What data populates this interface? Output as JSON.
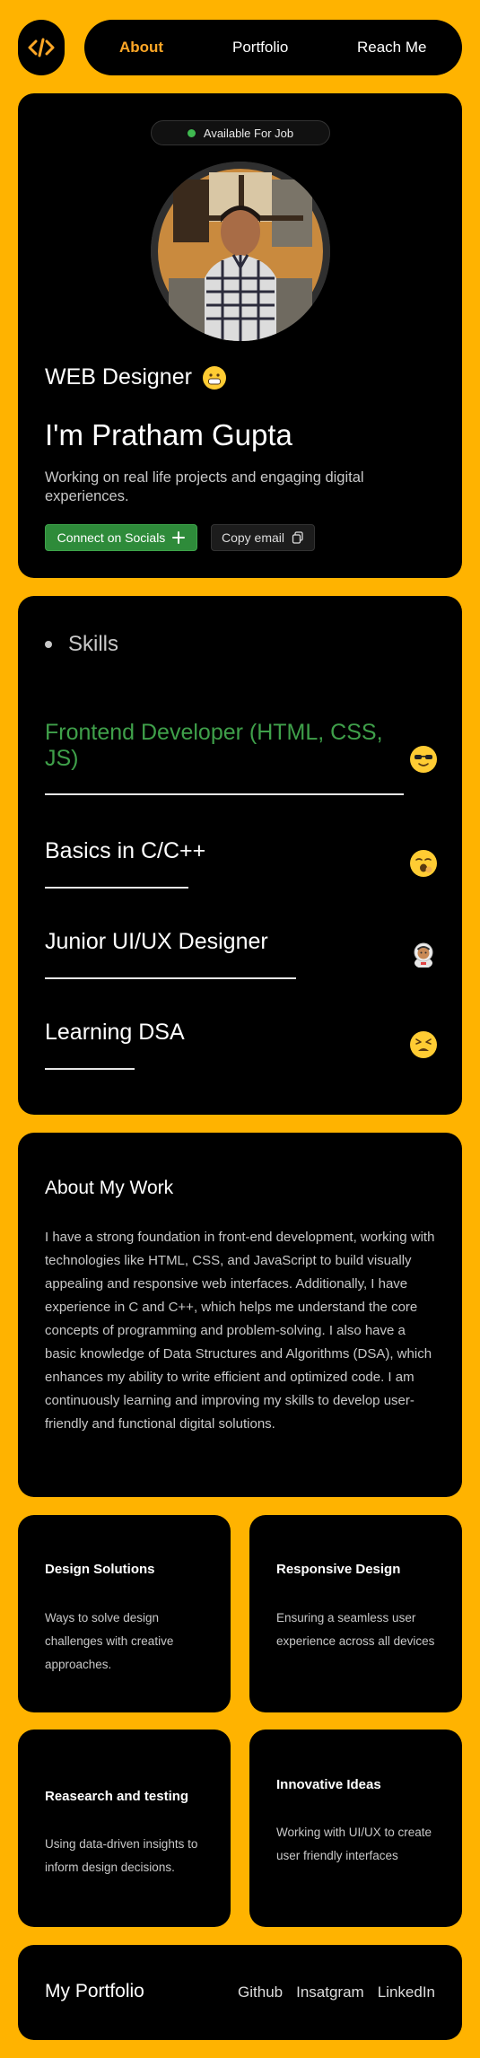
{
  "header": {
    "logo_icon": "code-icon",
    "nav": [
      {
        "label": "About",
        "active": true
      },
      {
        "label": "Portfolio",
        "active": false
      },
      {
        "label": "Reach Me",
        "active": false
      }
    ]
  },
  "hero": {
    "badge": "Available For Job",
    "role": "WEB Designer",
    "name": "I'm Pratham Gupta",
    "description": "Working on real life projects and engaging digital experiences.",
    "connect_button": "Connect on Socials",
    "copy_button": "Copy email"
  },
  "skills": {
    "title": "Skills",
    "items": [
      {
        "label": "Frontend Developer (HTML, CSS, JS)",
        "emoji": "sunglasses-face-icon"
      },
      {
        "label": "Basics in C/C++",
        "emoji": "yawning-face-icon"
      },
      {
        "label": "Junior UI/UX Designer",
        "emoji": "astronaut-icon"
      },
      {
        "label": "Learning DSA",
        "emoji": "tired-face-icon"
      }
    ]
  },
  "about": {
    "title": "About My Work",
    "body": "I have a strong foundation in front-end development, working with technologies like HTML, CSS, and JavaScript to build visually appealing and responsive web interfaces. Additionally, I have experience in C and C++, which helps me understand the core concepts of programming and problem-solving. I also have a basic knowledge of Data Structures and Algorithms (DSA), which enhances my ability to write efficient and optimized code. I am continuously learning and improving my skills to develop user-friendly and functional digital solutions."
  },
  "features": [
    {
      "title": "Design Solutions",
      "text": "Ways to solve design challenges with creative approaches."
    },
    {
      "title": "Responsive Design",
      "text": "Ensuring a seamless user experience across all devices"
    },
    {
      "title": "Reasearch and testing",
      "text": "Using data-driven insights to inform design decisions."
    },
    {
      "title": "Innovative Ideas",
      "text": "Working with UI/UX to create user friendly interfaces"
    }
  ],
  "footer": {
    "brand": "My Portfolio",
    "links": [
      "Github",
      "Insatgram",
      "LinkedIn"
    ]
  },
  "colors": {
    "background": "#ffb300",
    "card": "#000000",
    "accent_nav": "#ffa726",
    "accent_green": "#2e8b3a"
  }
}
